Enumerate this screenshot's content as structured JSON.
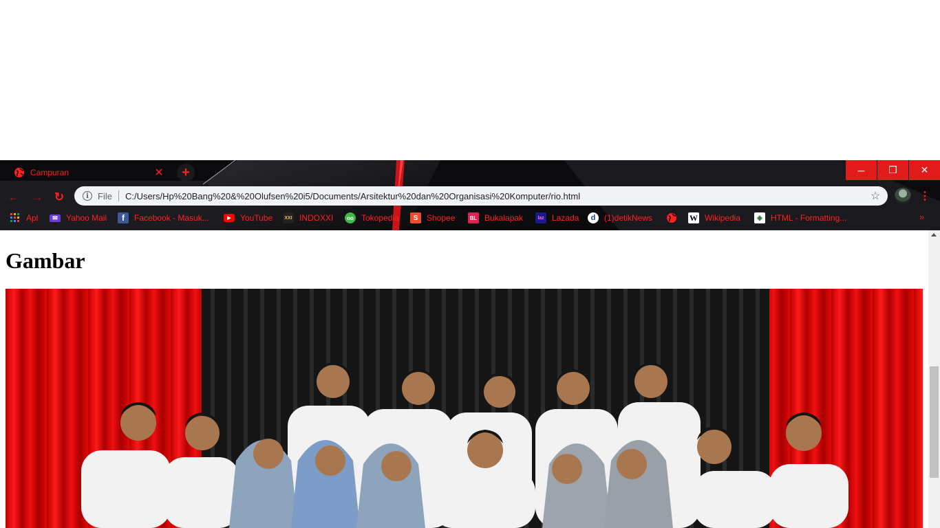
{
  "browser": {
    "tab": {
      "title": "Campuran",
      "close_label": "✕"
    },
    "new_tab_label": "+",
    "window_controls": {
      "minimize": "─",
      "restore": "❐",
      "close": "✕"
    },
    "nav": {
      "back": "←",
      "forward": "→",
      "reload": "↻"
    },
    "omnibox": {
      "info": "i",
      "scheme": "File",
      "url": "C:/Users/Hp%20Bang%20&%20Olufsen%20i5/Documents/Arsitektur%20dan%20Organisasi%20Komputer/rio.html",
      "star": "☆"
    },
    "menu": "⋮",
    "bookmarks": [
      {
        "label": "Apl",
        "icon": "apps-grid-icon"
      },
      {
        "label": "Yahoo Mail",
        "icon": "yahoo-mail-icon"
      },
      {
        "label": "Facebook - Masuk...",
        "icon": "facebook-icon"
      },
      {
        "label": "YouTube",
        "icon": "youtube-icon"
      },
      {
        "label": "INDOXXI",
        "icon": "indoxxi-icon"
      },
      {
        "label": "Tokopedia",
        "icon": "tokopedia-icon"
      },
      {
        "label": "Shopee",
        "icon": "shopee-icon"
      },
      {
        "label": "Bukalapak",
        "icon": "bukalapak-icon"
      },
      {
        "label": "Lazada",
        "icon": "lazada-icon"
      },
      {
        "label": "(1)detikNews",
        "icon": "detik-icon"
      },
      {
        "label": "",
        "icon": "globe-icon"
      },
      {
        "label": "Wikipedia",
        "icon": "wikipedia-icon"
      },
      {
        "label": "HTML - Formatting...",
        "icon": "tutorialspoint-icon"
      }
    ],
    "bookmarks_overflow": "»",
    "accent_color": "#ff2020"
  },
  "page": {
    "heading": "Gambar",
    "image": {
      "description_icon": "group-photo-image"
    }
  }
}
